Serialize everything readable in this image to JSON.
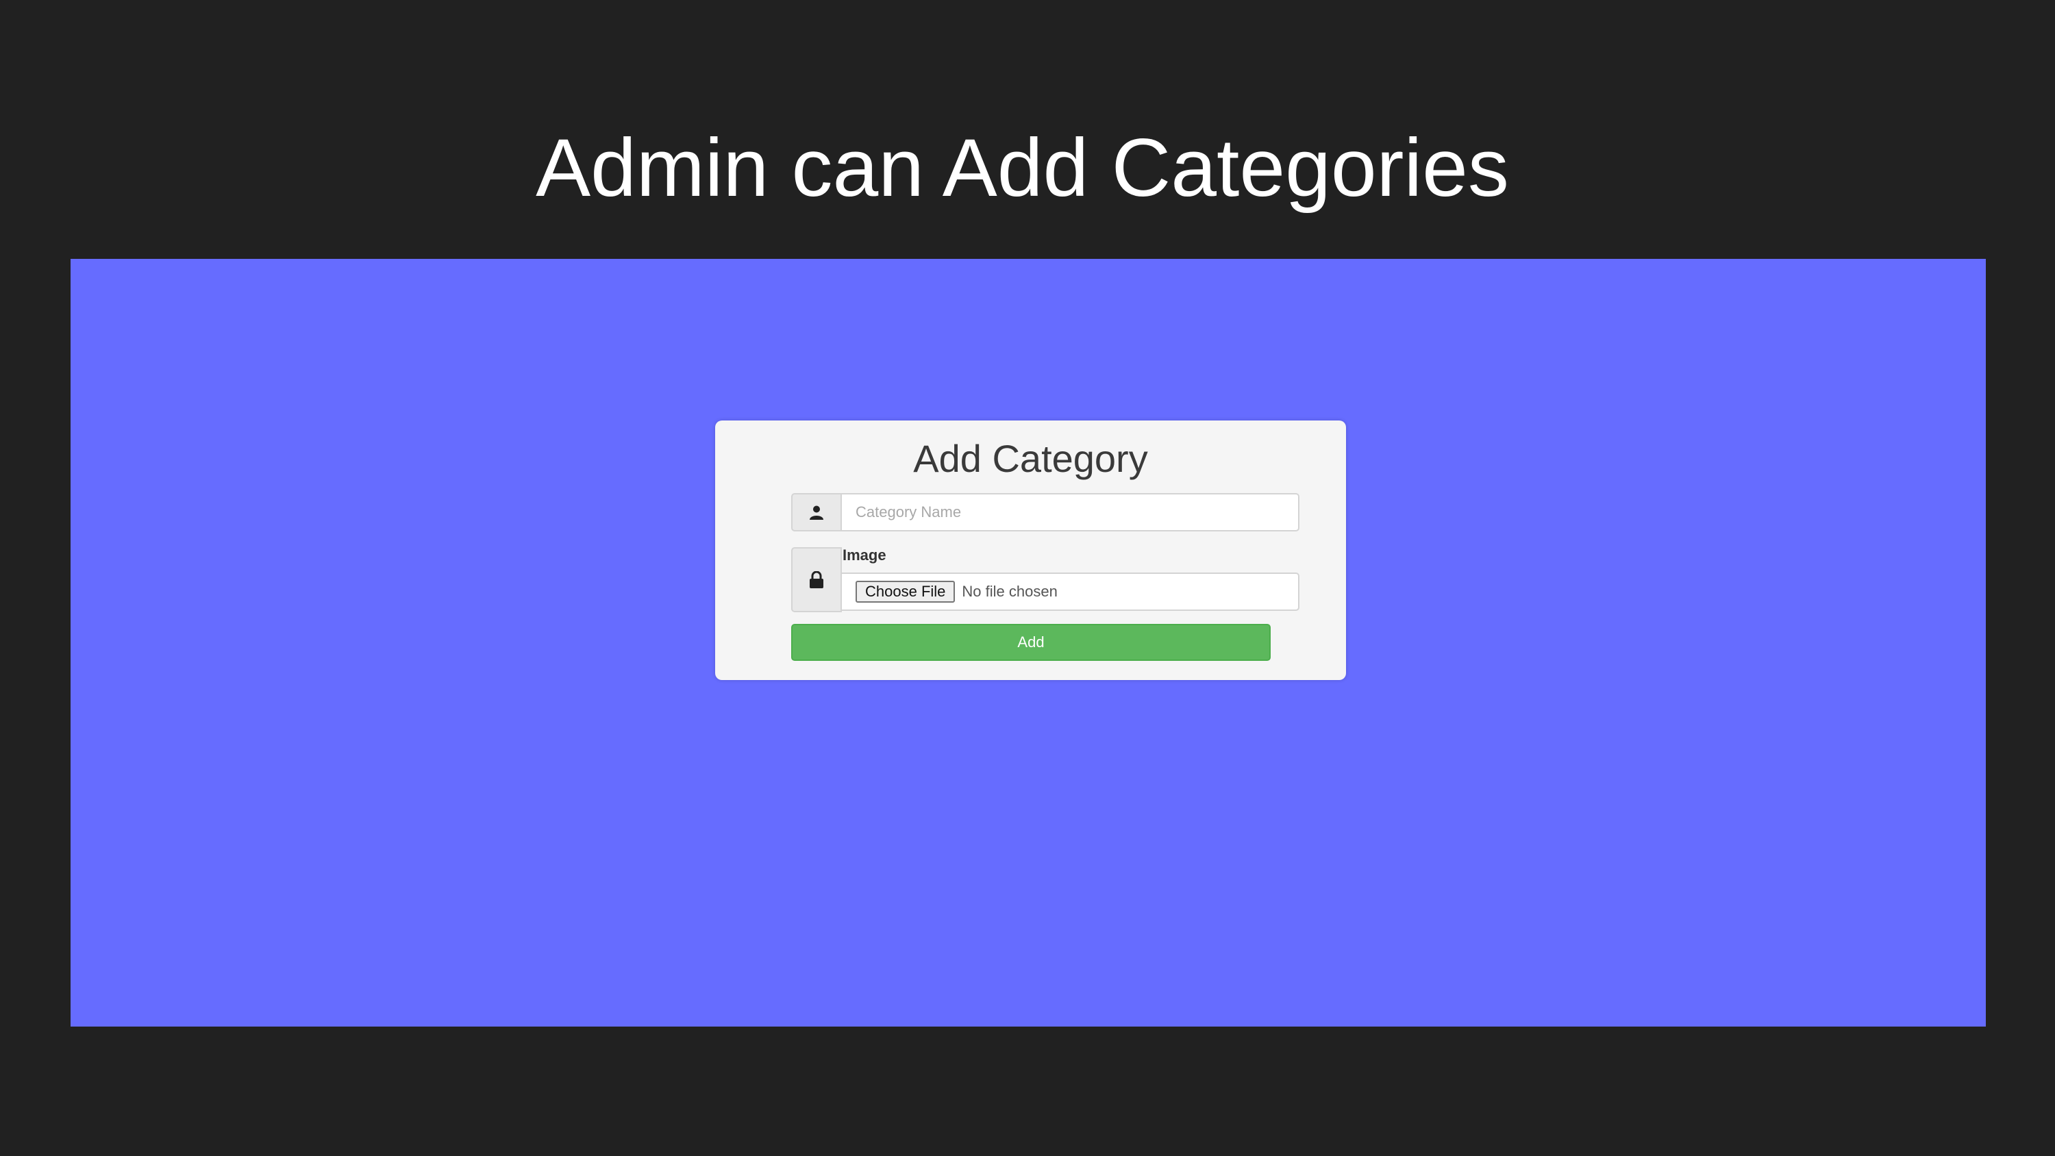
{
  "slide": {
    "title": "Admin can Add Categories",
    "background_color": "#212121"
  },
  "screenshot": {
    "background_color": "#666cff"
  },
  "form": {
    "title": "Add Category",
    "name_icon": "user-icon",
    "name_placeholder": "Category Name",
    "name_value": "",
    "image_icon": "lock-icon",
    "image_label": "Image",
    "choose_file_label": "Choose File",
    "file_status": "No file chosen",
    "submit_label": "Add",
    "submit_color": "#5cb85c"
  }
}
